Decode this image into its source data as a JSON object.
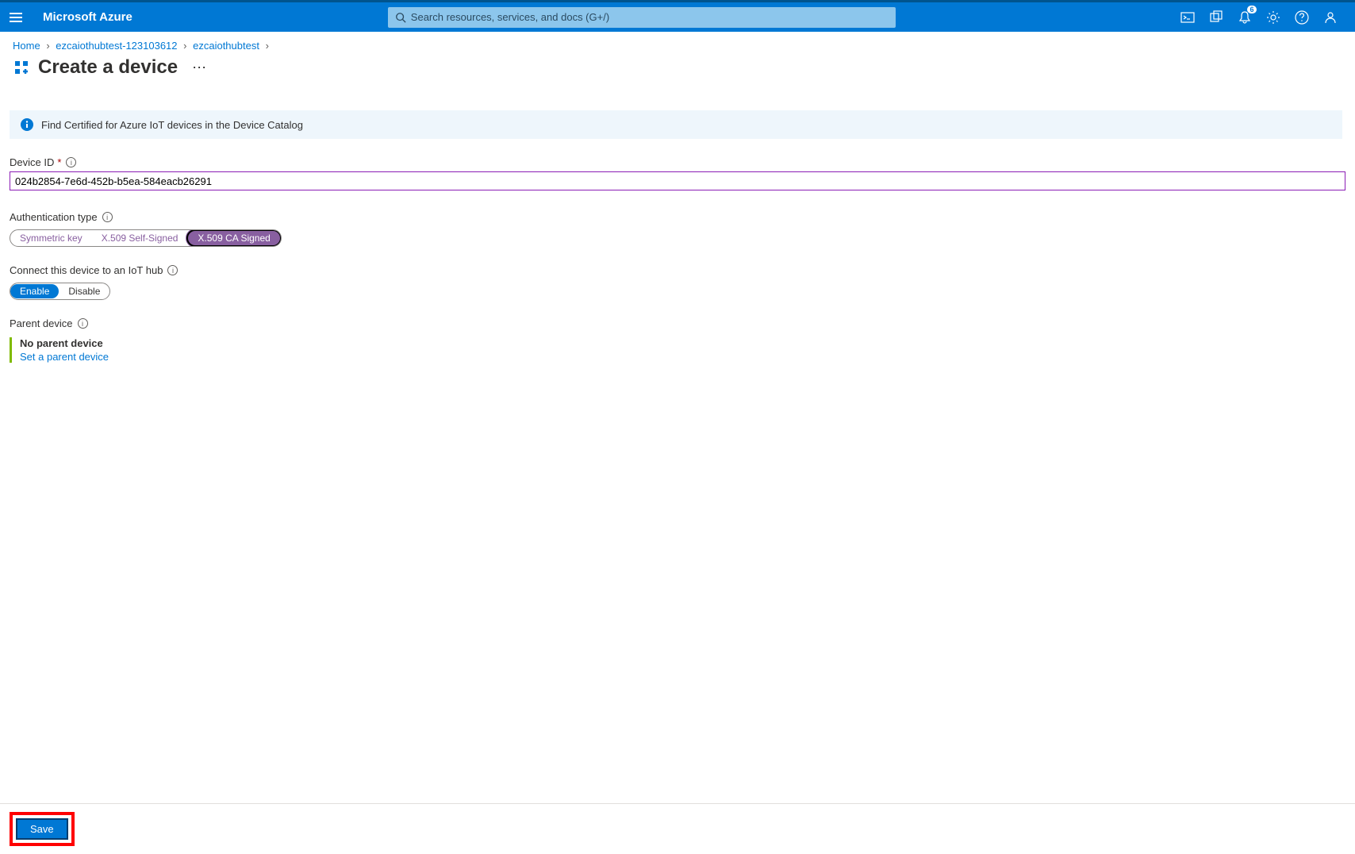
{
  "header": {
    "brand": "Microsoft Azure",
    "search_placeholder": "Search resources, services, and docs (G+/)",
    "notification_count": "6"
  },
  "breadcrumb": {
    "items": [
      "Home",
      "ezcaiothubtest-123103612",
      "ezcaiothubtest"
    ]
  },
  "page": {
    "title": "Create a device",
    "info_banner": "Find Certified for Azure IoT devices in the Device Catalog"
  },
  "form": {
    "device_id": {
      "label": "Device ID",
      "value": "024b2854-7e6d-452b-b5ea-584eacb26291"
    },
    "auth_type": {
      "label": "Authentication type",
      "options": [
        "Symmetric key",
        "X.509 Self-Signed",
        "X.509 CA Signed"
      ],
      "selected": "X.509 CA Signed"
    },
    "connect": {
      "label": "Connect this device to an IoT hub",
      "options": [
        "Enable",
        "Disable"
      ],
      "selected": "Enable"
    },
    "parent": {
      "label": "Parent device",
      "status": "No parent device",
      "action": "Set a parent device"
    }
  },
  "footer": {
    "save_label": "Save"
  }
}
